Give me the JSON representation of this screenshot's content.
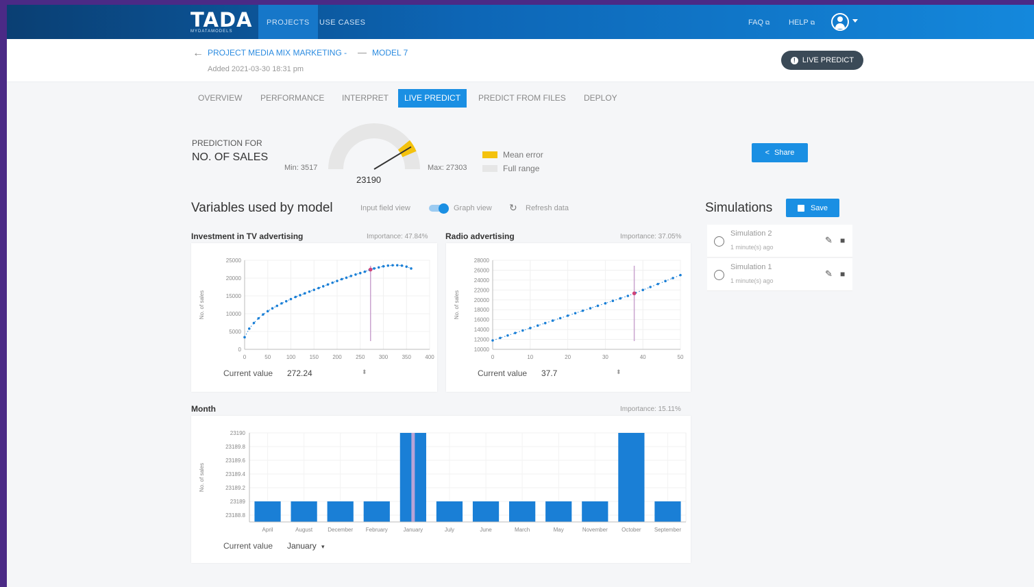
{
  "app": {
    "logo": "TADA",
    "logo_sub": "MYDATAMODELS",
    "nav": [
      "PROJECTS",
      "USE CASES"
    ],
    "top_links": [
      "FAQ",
      "HELP"
    ]
  },
  "header": {
    "breadcrumb_project": "PROJECT MEDIA MIX MARKETING -",
    "breadcrumb_model": "MODEL 7",
    "added": "Added 2021-03-30 18:31 pm",
    "live_predict_button": "LIVE PREDICT"
  },
  "tabs": [
    "OVERVIEW",
    "PERFORMANCE",
    "INTERPRET",
    "LIVE PREDICT",
    "PREDICT FROM FILES",
    "DEPLOY"
  ],
  "active_tab": "LIVE PREDICT",
  "prediction": {
    "label": "PREDICTION FOR",
    "target": "NO. OF SALES",
    "min_text": "Min: 3517",
    "max_text": "Max: 27303",
    "value_text": "23190",
    "min": 3517,
    "max": 27303,
    "value": 23190,
    "legend": [
      {
        "label": "Mean error",
        "color": "#f4c20d"
      },
      {
        "label": "Full range",
        "color": "#e6e6e6"
      }
    ],
    "share_button": "Share"
  },
  "variables": {
    "title": "Variables used by model",
    "input_field_view": "Input field view",
    "graph_view": "Graph view",
    "refresh": "Refresh data",
    "current_value_label": "Current value"
  },
  "tv_card": {
    "title": "Investment in TV advertising",
    "importance": "Importance: 47.84%",
    "current_value": "272.24",
    "chart_data": {
      "type": "line",
      "ylabel": "No. of sales",
      "xlim": [
        0,
        400
      ],
      "ylim": [
        0,
        25000
      ],
      "xticks": [
        "0",
        "50",
        "100",
        "150",
        "200",
        "250",
        "300",
        "350",
        "400"
      ],
      "yticks": [
        "0",
        "5000",
        "10000",
        "15000",
        "20000",
        "25000"
      ],
      "x": [
        0,
        10,
        20,
        30,
        40,
        50,
        60,
        70,
        80,
        90,
        100,
        110,
        120,
        130,
        140,
        150,
        160,
        170,
        180,
        190,
        200,
        210,
        220,
        230,
        240,
        250,
        260,
        270,
        280,
        290,
        300,
        310,
        320,
        330,
        340,
        350,
        360
      ],
      "y": [
        3400,
        5800,
        7400,
        8700,
        9800,
        10700,
        11500,
        12200,
        12900,
        13500,
        14100,
        14700,
        15200,
        15700,
        16200,
        16700,
        17200,
        17700,
        18200,
        18700,
        19200,
        19700,
        20100,
        20600,
        21000,
        21400,
        21800,
        22300,
        22700,
        23000,
        23300,
        23500,
        23600,
        23600,
        23500,
        23200,
        22700
      ],
      "current_x": 272.24,
      "marker_color": "#d0457a",
      "line_color": "#1a7fd6"
    }
  },
  "radio_card": {
    "title": "Radio advertising",
    "importance": "Importance: 37.05%",
    "current_value": "37.7",
    "chart_data": {
      "type": "line",
      "ylabel": "No. of sales",
      "xlim": [
        0,
        50
      ],
      "ylim": [
        10000,
        28000
      ],
      "xticks": [
        "0",
        "10",
        "20",
        "30",
        "40",
        "50"
      ],
      "yticks": [
        "10000",
        "12000",
        "14000",
        "16000",
        "18000",
        "20000",
        "22000",
        "24000",
        "26000",
        "28000"
      ],
      "x": [
        0,
        2,
        4,
        6,
        8,
        10,
        12,
        14,
        16,
        18,
        20,
        22,
        24,
        26,
        28,
        30,
        32,
        34,
        36,
        38,
        40,
        42,
        44,
        46,
        48,
        50
      ],
      "y": [
        11800,
        12300,
        12800,
        13300,
        13800,
        14300,
        14800,
        15300,
        15800,
        16300,
        16800,
        17300,
        17800,
        18300,
        18800,
        19300,
        19800,
        20300,
        20800,
        21400,
        22000,
        22600,
        23200,
        23800,
        24400,
        25000
      ],
      "current_x": 37.7,
      "marker_color": "#d0457a",
      "line_color": "#1a7fd6"
    }
  },
  "month_card": {
    "title": "Month",
    "importance": "Importance: 15.11%",
    "current_value": "January",
    "chart_data": {
      "type": "bar",
      "ylabel": "No. of sales",
      "ylim": [
        23188.7,
        23190
      ],
      "yticks": [
        "23188.8",
        "23189",
        "23189.2",
        "23189.4",
        "23189.6",
        "23189.8",
        "23190"
      ],
      "categories": [
        "April",
        "August",
        "December",
        "February",
        "January",
        "July",
        "June",
        "March",
        "May",
        "November",
        "October",
        "September"
      ],
      "values": [
        23189,
        23189,
        23189,
        23189,
        23190,
        23189,
        23189,
        23189,
        23189,
        23189,
        23190,
        23189
      ],
      "current_category": "January",
      "bar_color": "#1a7fd6",
      "highlight_color": "#b9a3d6"
    }
  },
  "simulations": {
    "title": "Simulations",
    "save_button": "Save",
    "items": [
      {
        "name": "Simulation 2",
        "time": "1 minute(s) ago"
      },
      {
        "name": "Simulation 1",
        "time": "1 minute(s) ago"
      }
    ]
  }
}
